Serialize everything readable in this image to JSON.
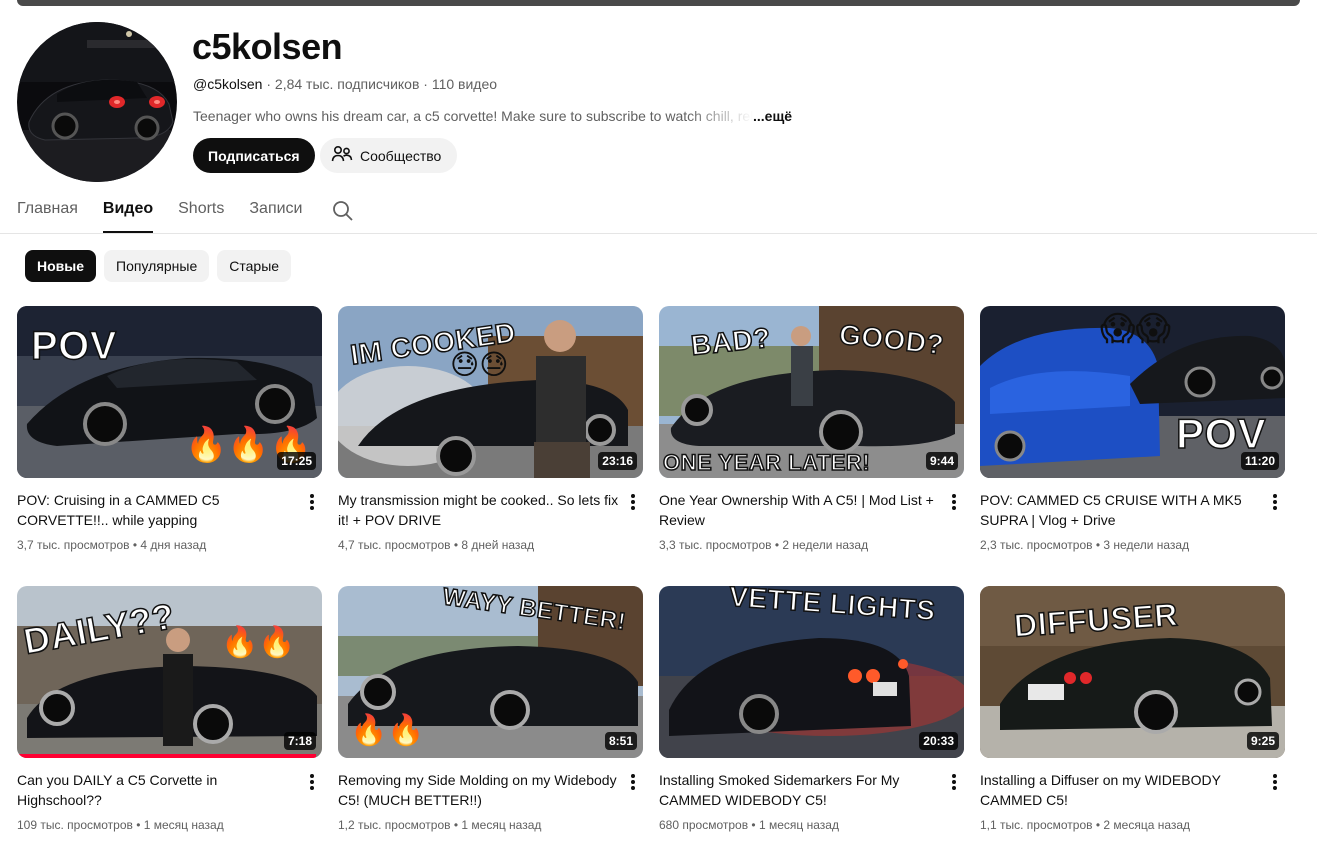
{
  "channel": {
    "name": "c5kolsen",
    "handle": "@c5kolsen",
    "meta": " · 2,84 тыс. подписчиков · 110 видео",
    "description": "Teenager who owns his dream car, a c5 corvette! Make sure to subscribe to watch chill, relaxing",
    "more": "...ещё",
    "subscribe_label": "Подписаться",
    "community_label": "Сообщество"
  },
  "tabs": [
    {
      "label": "Главная",
      "active": false
    },
    {
      "label": "Видео",
      "active": true
    },
    {
      "label": "Shorts",
      "active": false
    },
    {
      "label": "Записи",
      "active": false
    }
  ],
  "chips": [
    {
      "label": "Новые",
      "active": true
    },
    {
      "label": "Популярные",
      "active": false
    },
    {
      "label": "Старые",
      "active": false
    }
  ],
  "videos": [
    {
      "title": "POV: Cruising in a CAMMED C5 CORVETTE!!.. while yapping",
      "views": "3,7 тыс. просмотров",
      "age": "4 дня назад",
      "duration": "17:25",
      "overlay": "POV",
      "progress": 0
    },
    {
      "title": "My transmission might be cooked.. So lets fix it! + POV DRIVE",
      "views": "4,7 тыс. просмотров",
      "age": "8 дней назад",
      "duration": "23:16",
      "overlay": "IM COOKED",
      "progress": 0
    },
    {
      "title": "One Year Ownership With A C5! | Mod List + Review",
      "views": "3,3 тыс. просмотров",
      "age": "2 недели назад",
      "duration": "9:44",
      "overlay": "BAD?",
      "overlay2": "GOOD?",
      "overlay3": "ONE YEAR LATER!",
      "progress": 0
    },
    {
      "title": "POV: CAMMED C5 CRUISE WITH A MK5 SUPRA | Vlog + Drive",
      "views": "2,3 тыс. просмотров",
      "age": "3 недели назад",
      "duration": "11:20",
      "overlay": "POV",
      "progress": 0
    },
    {
      "title": "Can you DAILY a C5 Corvette in Highschool??",
      "views": "109 тыс. просмотров",
      "age": "1 месяц назад",
      "duration": "7:18",
      "overlay": "DAILY??",
      "progress": 0.98
    },
    {
      "title": "Removing my Side Molding on my Widebody C5! (MUCH BETTER!!)",
      "views": "1,2 тыс. просмотров",
      "age": "1 месяц назад",
      "duration": "8:51",
      "overlay": "WAYY BETTER!",
      "progress": 0
    },
    {
      "title": "Installing Smoked Sidemarkers For My CAMMED WIDEBODY C5!",
      "views": "680 просмотров",
      "age": "1 месяц назад",
      "duration": "20:33",
      "overlay": "VETTE LIGHTS",
      "progress": 0
    },
    {
      "title": "Installing a Diffuser on my WIDEBODY CAMMED C5!",
      "views": "1,1 тыс. просмотров",
      "age": "2 месяца назад",
      "duration": "9:25",
      "overlay": "DIFFUSER",
      "progress": 0
    }
  ],
  "colors": {
    "accent": "#0f0f0f",
    "secondary_text": "#606060",
    "progress_red": "#ff0033",
    "chip_bg": "#f2f2f2"
  }
}
